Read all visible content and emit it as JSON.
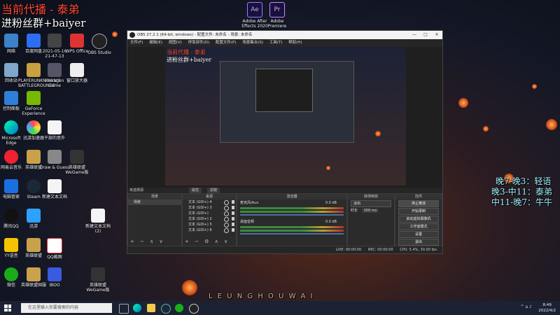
{
  "overlay": {
    "title_line": "当前代播 - 泰弟",
    "fans_line": "进粉丝群+baiyer",
    "schedule": [
      "晚7-晚3：轻语",
      "晚3-中11：泰弟",
      "中11-晚7：牛牛"
    ],
    "watermark": "L E U N G H O U W A I"
  },
  "desktop_icons": [
    {
      "label": "网络"
    },
    {
      "label": "百度网盘"
    },
    {
      "label": "2021-05-16 21-47-13"
    },
    {
      "label": "WPS Office"
    },
    {
      "label": "OBS Studio"
    },
    {
      "label": "回收站"
    },
    {
      "label": "PLAYERUNKNOWN'S BATTLEGROUNDS"
    },
    {
      "label": "Hexagon Game"
    },
    {
      "label": "窗口放大器"
    },
    {
      "label": "控制面板"
    },
    {
      "label": "GeForce Experience"
    },
    {
      "label": "Microsoft Edge"
    },
    {
      "label": "迅游加速器"
    },
    {
      "label": "干部的意外"
    },
    {
      "label": "网易云音乐"
    },
    {
      "label": "英雄联盟"
    },
    {
      "label": "Draw & Guess"
    },
    {
      "label": "英雄联盟 WeGame版"
    },
    {
      "label": "电脑管家"
    },
    {
      "label": "Steam"
    },
    {
      "label": "新建文本文档"
    },
    {
      "label": "腾讯QQ"
    },
    {
      "label": "迅游"
    },
    {
      "label": "新建文本文档 (2)"
    },
    {
      "label": "YY语音"
    },
    {
      "label": "英雄联盟"
    },
    {
      "label": "QQ截图"
    },
    {
      "label": "微信"
    },
    {
      "label": "英雄联盟国服"
    },
    {
      "label": "IBOO"
    },
    {
      "label": "英雄联盟 WeGame版"
    }
  ],
  "top_apps": [
    {
      "label": "Adobe After Effects 2020",
      "abbr": "Ae"
    },
    {
      "label": "Adobe Premiere",
      "abbr": "Pr"
    }
  ],
  "obs": {
    "title": "OBS 27.2.1 (64-bit, windows) - 配置文件: 未命名 - 场景: 未命名",
    "menu": [
      "文件(F)",
      "编辑(E)",
      "视图(V)",
      "停靠部件(D)",
      "配置文件(P)",
      "场景集合(S)",
      "工具(T)",
      "帮助(H)"
    ],
    "preview_text": [
      "当前代播 - 泰弟",
      "进粉丝群+baiyer"
    ],
    "source_bar": {
      "label": "未选择源",
      "props": "属性",
      "filters": "滤镜"
    },
    "docks": {
      "scenes": {
        "header": "场景",
        "items": [
          "场景"
        ]
      },
      "sources": {
        "header": "来源",
        "items": [
          "文本 (GDI+) 4",
          "文本 (GDI+) 3",
          "文本 (GDI+)",
          "文本 (GDI+) 2",
          "文本 (GDI+) 5",
          "文本 (GDI+) 6"
        ]
      },
      "mixer": {
        "header": "混音器",
        "channels": [
          {
            "name": "麦克风/Aux",
            "db": "0.0 dB"
          },
          {
            "name": "桌面音频",
            "db": "0.0 dB"
          }
        ]
      },
      "transitions": {
        "header": "转场特效",
        "type": "淡出",
        "duration_label": "时长",
        "duration": "300 ms"
      },
      "controls": {
        "header": "控件",
        "buttons": [
          "停止推流",
          "开始录制",
          "启动虚拟摄像机",
          "工作室模式",
          "设置",
          "退出"
        ]
      }
    },
    "status": {
      "live": "LIVE: 00:00:00",
      "rec": "REC: 00:00:00",
      "cpu": "CPU: 5.4%, 30.00 fps",
      "dropped": "00:00:00"
    }
  },
  "taskbar": {
    "search_placeholder": "在这里输入你要搜索的内容",
    "time": "8:49",
    "date": "2022/4/2"
  },
  "colors": {
    "overlay_red": "#ff4a3a",
    "overlay_cyan": "#9ff0ff",
    "overlay_white": "#ffffff"
  }
}
